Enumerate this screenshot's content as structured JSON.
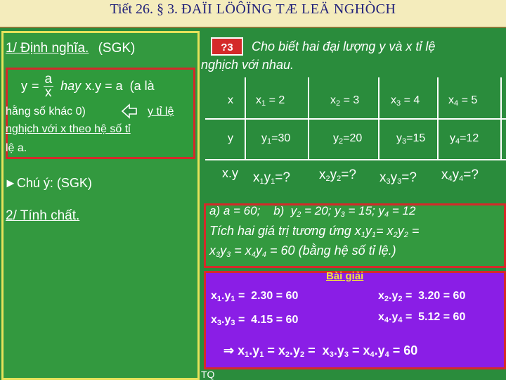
{
  "title": {
    "prefix": "Tiết 26. § 3. ",
    "main": "ĐAÏI LÖÔÏNG TÆ LEÄ NGHÒCH"
  },
  "left": {
    "section1_label": "1/ Định nghĩa.",
    "section1_ref": "(SGK)",
    "def_y": "y",
    "def_eq": "=",
    "def_num": "a",
    "def_den": "x",
    "def_hay": "hay",
    "def_xy": "x.y = a",
    "def_paren": "(a là",
    "def_line2a": "hằng số khác 0)",
    "def_line2b": "y tỉ lệ",
    "def_line3": "nghịch với x theo hệ số tỉ",
    "def_line4": "lệ a.",
    "note": "►Chú ý: (SGK)",
    "section2": "2/ Tính chất."
  },
  "question": {
    "label": "?3",
    "line1": "Cho biết hai đại lượng y và x tỉ lệ",
    "line2": "nghịch với nhau."
  },
  "table": {
    "row_x": {
      "head": "x",
      "cells": [
        "x1 = 2",
        "x2 = 3",
        "x3 = 4",
        "x4 = 5"
      ]
    },
    "row_y": {
      "head": "y",
      "cells": [
        "y1=30",
        "y2=20",
        "y3=15",
        "y4=12"
      ]
    },
    "row_xy": {
      "head": "x.y",
      "cells": [
        "x1y1=?",
        "x2y2=?",
        "x3y3=?",
        "x4y4=?"
      ]
    }
  },
  "answer": {
    "line1": "a) a = 60;    b)  y2 = 20; y3 = 15; y4 = 12",
    "line2": "Tích hai giá trị tương ứng x1y1= x2y2 =",
    "line3a": "x3y3 = x4y4 = 60",
    "line3b": "(bằng hệ số tỉ lệ.)"
  },
  "solution": {
    "heading": "Bài giải",
    "r1": "x1.y1 =  2.30 = 60",
    "r2": "x2.y2 =  3.20 = 60",
    "r3": "x3.y3 =  4.15 = 60",
    "r4": "x4.y4 =  5.12 = 60",
    "conclusion": "x1.y1 = x2.y2 =  x3.y3 = x4.y4 = 60",
    "implies": "⇒"
  },
  "footer": "TQ",
  "colors": {
    "background": "#2a8c3c",
    "panel_border": "#e6e25a",
    "red": "#d42a2a",
    "purple": "#8a1ee6"
  }
}
